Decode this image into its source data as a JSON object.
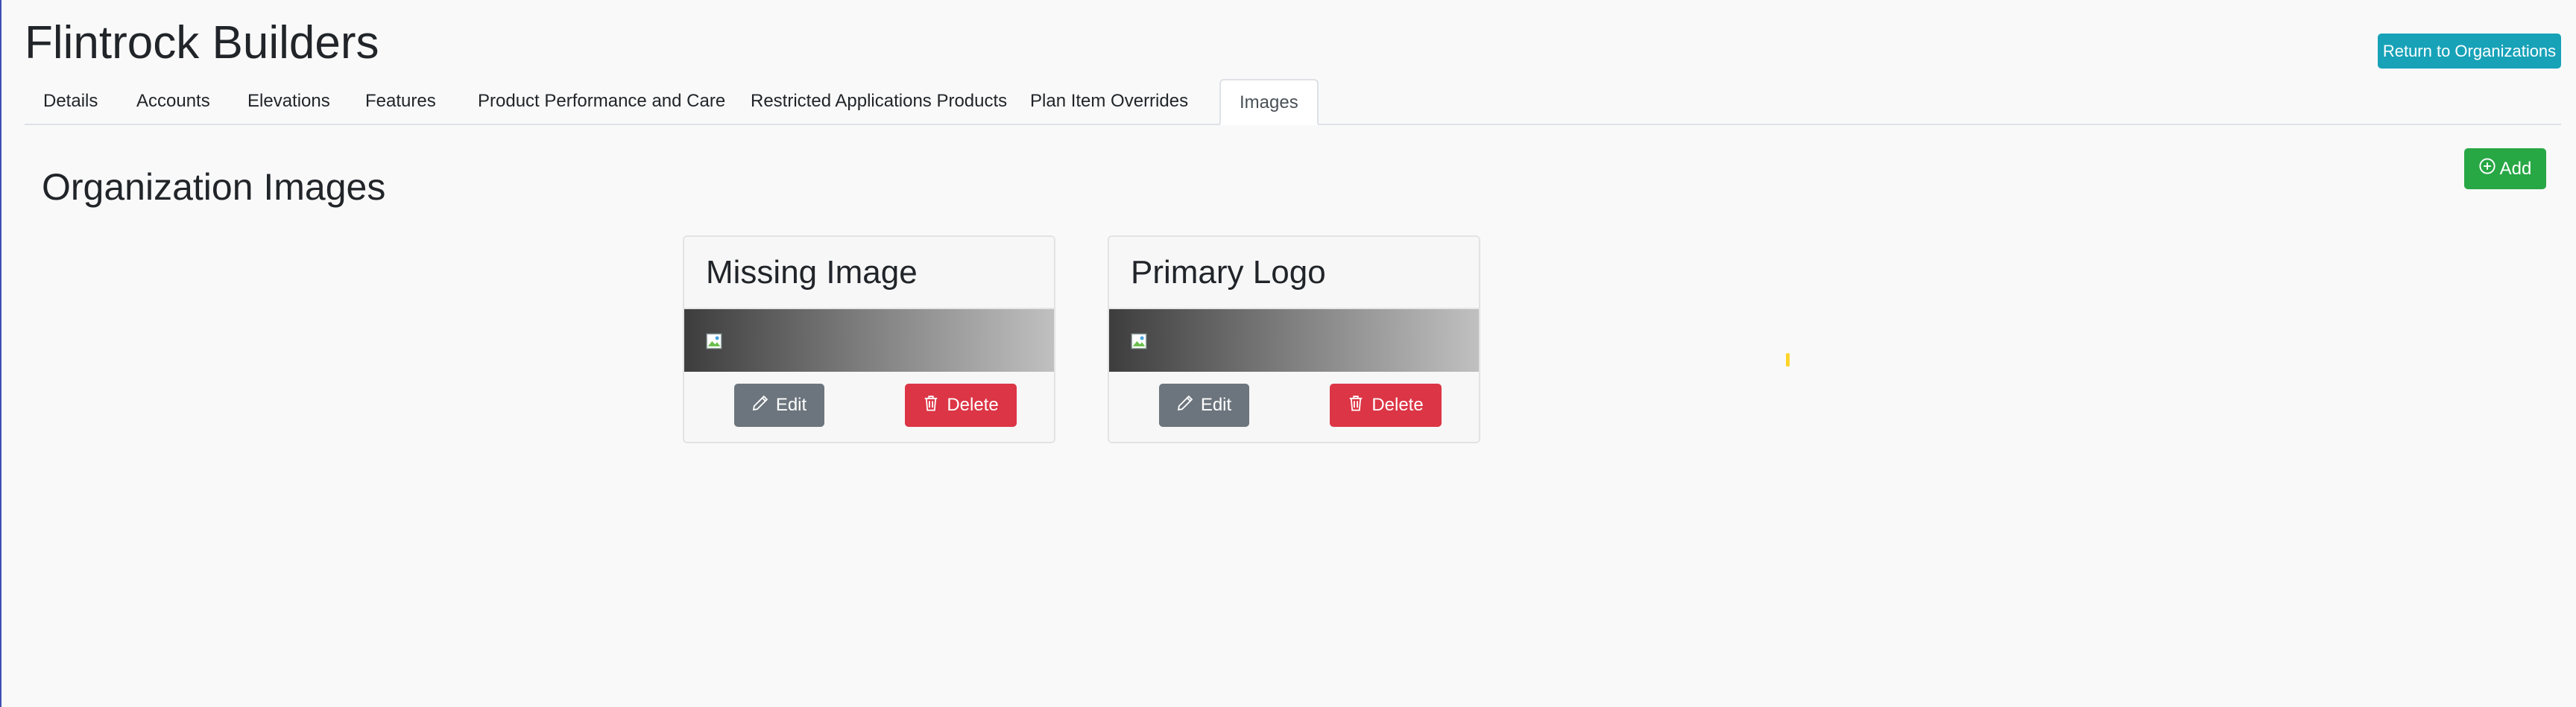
{
  "header": {
    "title": "Flintrock Builders",
    "return_label": "Return to Organizations"
  },
  "tabs": [
    {
      "label": "Details"
    },
    {
      "label": "Accounts"
    },
    {
      "label": "Elevations"
    },
    {
      "label": "Features"
    },
    {
      "label": "Product Performance and Care"
    },
    {
      "label": "Restricted Applications Products"
    },
    {
      "label": "Plan Item Overrides"
    },
    {
      "label": "Images",
      "active": true
    }
  ],
  "section": {
    "title": "Organization Images",
    "add_label": "Add"
  },
  "cards": [
    {
      "title": "Missing Image",
      "edit_label": "Edit",
      "delete_label": "Delete"
    },
    {
      "title": "Primary Logo",
      "edit_label": "Edit",
      "delete_label": "Delete"
    }
  ],
  "colors": {
    "info": "#17a2b8",
    "success": "#28a745",
    "secondary": "#6c757d",
    "danger": "#dc3545"
  },
  "icons": [
    "plus-circle-icon",
    "pencil-icon",
    "trash-icon",
    "broken-image-icon"
  ]
}
